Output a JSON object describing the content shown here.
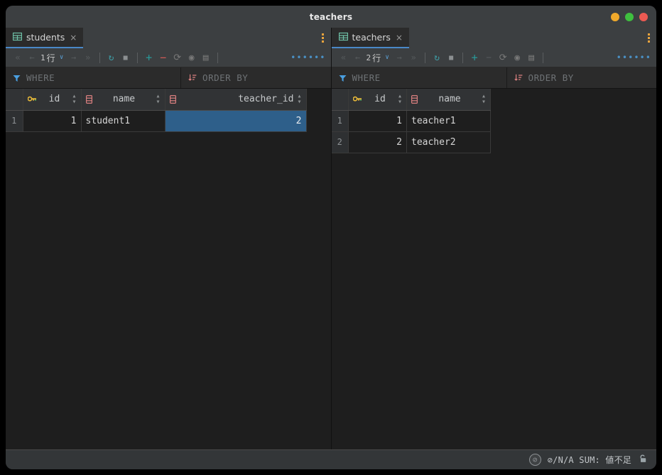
{
  "window": {
    "title": "teachers",
    "controls": [
      {
        "name": "minimize-button",
        "color": "#f0a92b"
      },
      {
        "name": "maximize-button",
        "color": "#3fbf3f"
      },
      {
        "name": "close-button",
        "color": "#ec5a52"
      }
    ]
  },
  "panels": [
    {
      "id": "students",
      "tab": {
        "label": "students",
        "close": "×",
        "icon": "table-icon"
      },
      "kebab": "more-options-icon",
      "toolbar": {
        "first": "«",
        "prev": "←",
        "rowcount_number": "1",
        "rowcount_unit": "行",
        "caret": "∨",
        "next": "→",
        "last": "»",
        "refresh": "↻",
        "stop": "■",
        "add_row": "+",
        "delete_row": "−",
        "revert": "⟳",
        "preview": "◉",
        "save": "▤",
        "more": "•••",
        "more2": "•••",
        "delete_enabled": true
      },
      "filter": {
        "where_label": "WHERE",
        "order_label": "ORDER BY"
      },
      "grid": {
        "columns": [
          {
            "name": "id",
            "icon": "primary-key-icon",
            "align": "num"
          },
          {
            "name": "name",
            "icon": "field-icon",
            "align": "txt"
          },
          {
            "name": "teacher_id",
            "icon": "field-icon",
            "align": "num"
          }
        ],
        "rows": [
          {
            "number": "1",
            "cells": [
              "1",
              "student1",
              "2"
            ],
            "selected_index": 2
          }
        ]
      }
    },
    {
      "id": "teachers",
      "tab": {
        "label": "teachers",
        "close": "×",
        "icon": "table-icon"
      },
      "kebab": "more-options-icon",
      "toolbar": {
        "first": "«",
        "prev": "←",
        "rowcount_number": "2",
        "rowcount_unit": "行",
        "caret": "∨",
        "next": "→",
        "last": "»",
        "refresh": "↻",
        "stop": "■",
        "add_row": "+",
        "delete_row": "−",
        "revert": "⟳",
        "preview": "◉",
        "save": "▤",
        "more": "•••",
        "more2": "•••",
        "delete_enabled": false
      },
      "filter": {
        "where_label": "WHERE",
        "order_label": "ORDER BY"
      },
      "grid": {
        "columns": [
          {
            "name": "id",
            "icon": "primary-key-icon",
            "align": "num"
          },
          {
            "name": "name",
            "icon": "field-icon",
            "align": "txt"
          }
        ],
        "rows": [
          {
            "number": "1",
            "cells": [
              "1",
              "teacher1"
            ],
            "selected_index": -1
          },
          {
            "number": "2",
            "cells": [
              "2",
              "teacher2"
            ],
            "selected_index": -1
          }
        ]
      }
    }
  ],
  "statusbar": {
    "chip": "⊘",
    "text": "⊘/N/A  SUM: 値不足",
    "lock": "unlock-icon"
  },
  "colors": {
    "accent": "#4a88c7",
    "selection": "#2e5f8a",
    "titlebar": "#3c3f41",
    "grid_bg": "#1e1e1e",
    "header_bg": "#313335",
    "key_icon": "#e8b93a",
    "field_icon": "#d97f7f",
    "funnel": "#4a9fe0",
    "sort": "#d97f7f",
    "kebab": "#e8a33d"
  }
}
